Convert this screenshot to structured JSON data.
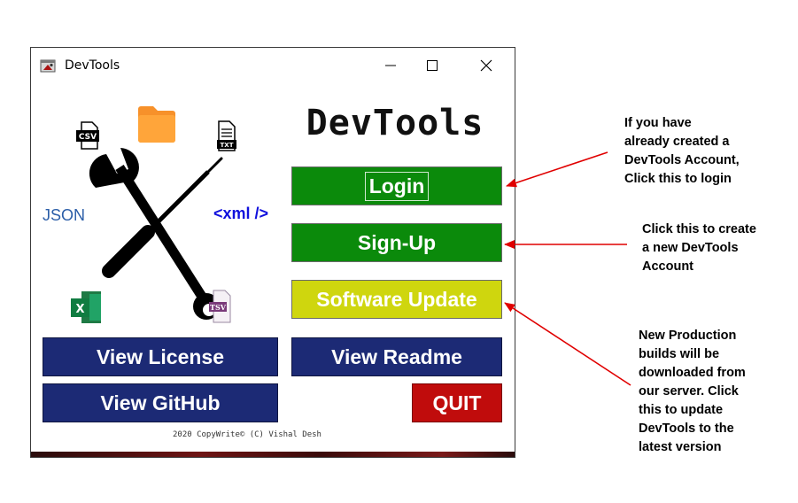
{
  "window": {
    "title": "DevTools",
    "icons": {
      "app": "app-icon",
      "minimize": "minimize-icon",
      "maximize": "maximize-icon",
      "close": "close-icon"
    }
  },
  "app": {
    "logo_text": "DevTools",
    "art": {
      "json_label": "JSON",
      "xml_label": "<xml />",
      "csv_label": "CSV",
      "txt_label": "TXT",
      "tsv_label": "TSV",
      "excel_label": "X",
      "icons": [
        "csv-file-icon",
        "folder-icon",
        "txt-file-icon",
        "json-text",
        "xml-text",
        "excel-icon",
        "tsv-file-icon",
        "crossed-tools-icon"
      ]
    },
    "buttons": {
      "login": "Login",
      "signup": "Sign-Up",
      "update": "Software Update",
      "license": "View License",
      "readme": "View Readme",
      "github": "View GitHub",
      "quit": "QUIT"
    },
    "copyright": "2020 CopyWrite© (C) Vishal Desh"
  },
  "annotations": {
    "login": [
      "If you have",
      "already created a",
      "DevTools Account,",
      "Click this to login"
    ],
    "signup": [
      "Click this to create",
      "a new DevTools",
      "Account"
    ],
    "update": [
      "New Production",
      "builds will be",
      "downloaded from",
      "our server. Click",
      "this to update",
      "DevTools to the",
      "latest version"
    ]
  },
  "colors": {
    "green_button": "#0b8a0b",
    "yellow_button": "#cfd60e",
    "navy_button": "#1c2a75",
    "red_button": "#c00c0c",
    "arrow": "#e00000"
  }
}
